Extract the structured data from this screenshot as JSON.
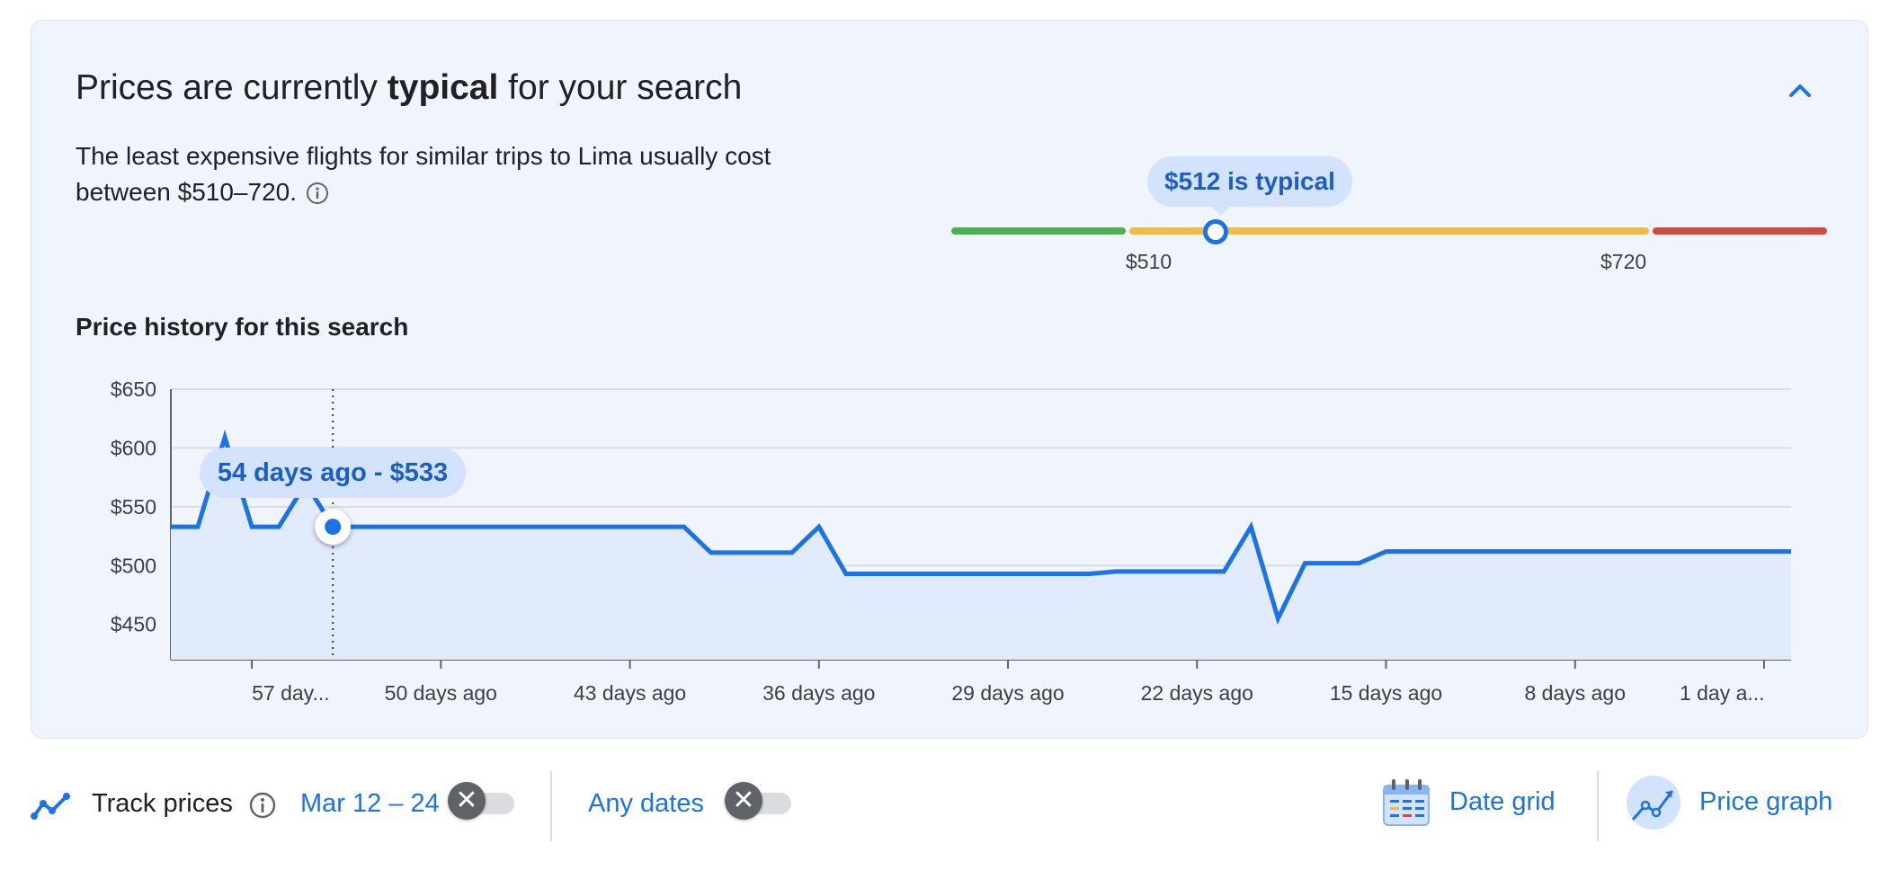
{
  "header": {
    "title_prefix": "Prices are currently ",
    "title_emphasis": "typical",
    "title_suffix": " for your search",
    "description": "The least expensive flights for similar trips to Lima usually cost between $510–720."
  },
  "price_range": {
    "indicator_label": "$512 is typical",
    "low_label": "$510",
    "high_label": "$720",
    "current": 512,
    "colors": {
      "low": "#4caf50",
      "typical": "#f1bb40",
      "high": "#d44a3a",
      "marker": "#1a73e8"
    }
  },
  "history": {
    "title": "Price history for this search",
    "tooltip": "54 days ago - $533"
  },
  "chart_data": {
    "type": "line",
    "title": "",
    "xlabel": "",
    "ylabel": "",
    "x_unit": "days ago",
    "ylim": [
      420,
      650
    ],
    "y_ticks": [
      650,
      600,
      550,
      500,
      450
    ],
    "y_tick_labels": [
      "$650",
      "$600",
      "$550",
      "$500",
      "$450"
    ],
    "x_ticks": [
      57,
      50,
      43,
      36,
      29,
      22,
      15,
      8,
      1
    ],
    "x_tick_labels": [
      "57 day...",
      "50 days ago",
      "43 days ago",
      "36 days ago",
      "29 days ago",
      "22 days ago",
      "15 days ago",
      "8 days ago",
      "1 day a..."
    ],
    "xlim": [
      60,
      0
    ],
    "grid": true,
    "highlight": {
      "x": 54,
      "y": 533
    },
    "series": [
      {
        "x": [
          60,
          59,
          58,
          57,
          56,
          55,
          54,
          53,
          52,
          51,
          50,
          49,
          48,
          47,
          46,
          45,
          44,
          43,
          42,
          41,
          40,
          39,
          38,
          37,
          36,
          35,
          34,
          33,
          32,
          31,
          30,
          29,
          28,
          27,
          26,
          25,
          24,
          23,
          22,
          21,
          20,
          19,
          18,
          17,
          16,
          15,
          14,
          13,
          12,
          11,
          10,
          9,
          8,
          7,
          6,
          5,
          4,
          3,
          2,
          1,
          0
        ],
        "values": [
          533,
          533,
          609,
          533,
          533,
          570,
          533,
          533,
          533,
          533,
          533,
          533,
          533,
          533,
          533,
          533,
          533,
          533,
          533,
          533,
          511,
          511,
          511,
          511,
          533,
          493,
          493,
          493,
          493,
          493,
          493,
          493,
          493,
          493,
          493,
          495,
          495,
          495,
          495,
          495,
          533,
          455,
          502,
          502,
          502,
          512,
          512,
          512,
          512,
          512,
          512,
          512,
          512,
          512,
          512,
          512,
          512,
          512,
          512,
          512,
          512
        ]
      }
    ],
    "colors": {
      "line": "#1a73e8",
      "fill": "#e2ebfb",
      "grid": "#dadce0"
    }
  },
  "bottom": {
    "track_label": "Track prices",
    "date_range": "Mar 12 – 24",
    "any_dates": "Any dates",
    "date_grid": "Date grid",
    "price_graph": "Price graph"
  }
}
